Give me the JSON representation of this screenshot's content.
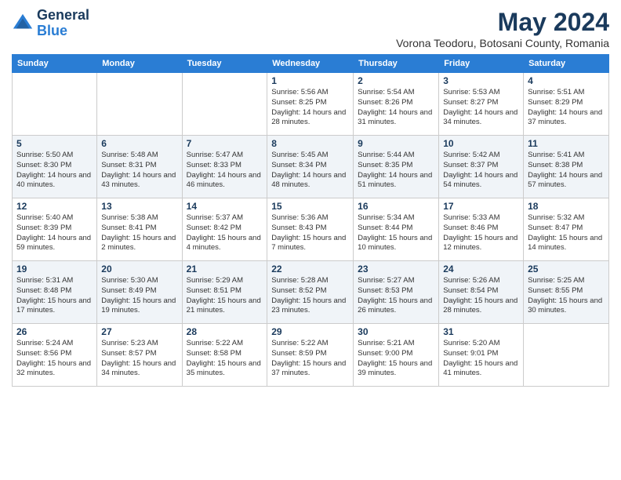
{
  "logo": {
    "general": "General",
    "blue": "Blue"
  },
  "title": "May 2024",
  "location": "Vorona Teodoru, Botosani County, Romania",
  "headers": [
    "Sunday",
    "Monday",
    "Tuesday",
    "Wednesday",
    "Thursday",
    "Friday",
    "Saturday"
  ],
  "weeks": [
    [
      {
        "day": "",
        "info": ""
      },
      {
        "day": "",
        "info": ""
      },
      {
        "day": "",
        "info": ""
      },
      {
        "day": "1",
        "info": "Sunrise: 5:56 AM\nSunset: 8:25 PM\nDaylight: 14 hours\nand 28 minutes."
      },
      {
        "day": "2",
        "info": "Sunrise: 5:54 AM\nSunset: 8:26 PM\nDaylight: 14 hours\nand 31 minutes."
      },
      {
        "day": "3",
        "info": "Sunrise: 5:53 AM\nSunset: 8:27 PM\nDaylight: 14 hours\nand 34 minutes."
      },
      {
        "day": "4",
        "info": "Sunrise: 5:51 AM\nSunset: 8:29 PM\nDaylight: 14 hours\nand 37 minutes."
      }
    ],
    [
      {
        "day": "5",
        "info": "Sunrise: 5:50 AM\nSunset: 8:30 PM\nDaylight: 14 hours\nand 40 minutes."
      },
      {
        "day": "6",
        "info": "Sunrise: 5:48 AM\nSunset: 8:31 PM\nDaylight: 14 hours\nand 43 minutes."
      },
      {
        "day": "7",
        "info": "Sunrise: 5:47 AM\nSunset: 8:33 PM\nDaylight: 14 hours\nand 46 minutes."
      },
      {
        "day": "8",
        "info": "Sunrise: 5:45 AM\nSunset: 8:34 PM\nDaylight: 14 hours\nand 48 minutes."
      },
      {
        "day": "9",
        "info": "Sunrise: 5:44 AM\nSunset: 8:35 PM\nDaylight: 14 hours\nand 51 minutes."
      },
      {
        "day": "10",
        "info": "Sunrise: 5:42 AM\nSunset: 8:37 PM\nDaylight: 14 hours\nand 54 minutes."
      },
      {
        "day": "11",
        "info": "Sunrise: 5:41 AM\nSunset: 8:38 PM\nDaylight: 14 hours\nand 57 minutes."
      }
    ],
    [
      {
        "day": "12",
        "info": "Sunrise: 5:40 AM\nSunset: 8:39 PM\nDaylight: 14 hours\nand 59 minutes."
      },
      {
        "day": "13",
        "info": "Sunrise: 5:38 AM\nSunset: 8:41 PM\nDaylight: 15 hours\nand 2 minutes."
      },
      {
        "day": "14",
        "info": "Sunrise: 5:37 AM\nSunset: 8:42 PM\nDaylight: 15 hours\nand 4 minutes."
      },
      {
        "day": "15",
        "info": "Sunrise: 5:36 AM\nSunset: 8:43 PM\nDaylight: 15 hours\nand 7 minutes."
      },
      {
        "day": "16",
        "info": "Sunrise: 5:34 AM\nSunset: 8:44 PM\nDaylight: 15 hours\nand 10 minutes."
      },
      {
        "day": "17",
        "info": "Sunrise: 5:33 AM\nSunset: 8:46 PM\nDaylight: 15 hours\nand 12 minutes."
      },
      {
        "day": "18",
        "info": "Sunrise: 5:32 AM\nSunset: 8:47 PM\nDaylight: 15 hours\nand 14 minutes."
      }
    ],
    [
      {
        "day": "19",
        "info": "Sunrise: 5:31 AM\nSunset: 8:48 PM\nDaylight: 15 hours\nand 17 minutes."
      },
      {
        "day": "20",
        "info": "Sunrise: 5:30 AM\nSunset: 8:49 PM\nDaylight: 15 hours\nand 19 minutes."
      },
      {
        "day": "21",
        "info": "Sunrise: 5:29 AM\nSunset: 8:51 PM\nDaylight: 15 hours\nand 21 minutes."
      },
      {
        "day": "22",
        "info": "Sunrise: 5:28 AM\nSunset: 8:52 PM\nDaylight: 15 hours\nand 23 minutes."
      },
      {
        "day": "23",
        "info": "Sunrise: 5:27 AM\nSunset: 8:53 PM\nDaylight: 15 hours\nand 26 minutes."
      },
      {
        "day": "24",
        "info": "Sunrise: 5:26 AM\nSunset: 8:54 PM\nDaylight: 15 hours\nand 28 minutes."
      },
      {
        "day": "25",
        "info": "Sunrise: 5:25 AM\nSunset: 8:55 PM\nDaylight: 15 hours\nand 30 minutes."
      }
    ],
    [
      {
        "day": "26",
        "info": "Sunrise: 5:24 AM\nSunset: 8:56 PM\nDaylight: 15 hours\nand 32 minutes."
      },
      {
        "day": "27",
        "info": "Sunrise: 5:23 AM\nSunset: 8:57 PM\nDaylight: 15 hours\nand 34 minutes."
      },
      {
        "day": "28",
        "info": "Sunrise: 5:22 AM\nSunset: 8:58 PM\nDaylight: 15 hours\nand 35 minutes."
      },
      {
        "day": "29",
        "info": "Sunrise: 5:22 AM\nSunset: 8:59 PM\nDaylight: 15 hours\nand 37 minutes."
      },
      {
        "day": "30",
        "info": "Sunrise: 5:21 AM\nSunset: 9:00 PM\nDaylight: 15 hours\nand 39 minutes."
      },
      {
        "day": "31",
        "info": "Sunrise: 5:20 AM\nSunset: 9:01 PM\nDaylight: 15 hours\nand 41 minutes."
      },
      {
        "day": "",
        "info": ""
      }
    ]
  ]
}
